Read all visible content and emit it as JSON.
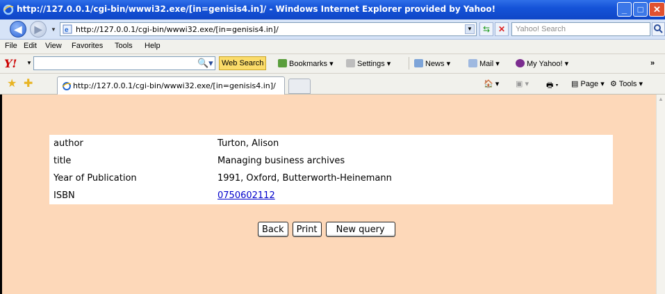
{
  "window": {
    "title": "http://127.0.0.1/cgi-bin/wwwi32.exe/[in=genisis4.in]/ - Windows Internet Explorer provided by Yahoo!"
  },
  "addressbar": {
    "url": "http://127.0.0.1/cgi-bin/wwwi32.exe/[in=genisis4.in]/",
    "search_placeholder": "Yahoo! Search"
  },
  "menu": {
    "items": [
      "File",
      "Edit",
      "View",
      "Favorites",
      "Tools",
      "Help"
    ]
  },
  "yahoo_toolbar": {
    "web_search": "Web Search",
    "bookmarks": "Bookmarks",
    "settings": "Settings",
    "news": "News",
    "mail": "Mail",
    "my_yahoo": "My Yahoo!",
    "more": "»"
  },
  "tabs": {
    "active_tab": "http://127.0.0.1/cgi-bin/wwwi32.exe/[in=genisis4.in]/"
  },
  "command_bar": {
    "page": "Page",
    "tools": "Tools"
  },
  "record": {
    "rows": [
      {
        "label": "author",
        "value": "Turton, Alison"
      },
      {
        "label": "title",
        "value": "Managing business archives"
      },
      {
        "label": "Year of Publication",
        "value": "1991, Oxford, Butterworth-Heinemann"
      },
      {
        "label": "ISBN",
        "value": "0750602112"
      }
    ]
  },
  "actions": {
    "back": "Back",
    "print": "Print",
    "new_query": "New query"
  },
  "colors": {
    "content_background": "#fdd8b9",
    "titlebar": "#1553d8",
    "link": "#0000cc"
  }
}
